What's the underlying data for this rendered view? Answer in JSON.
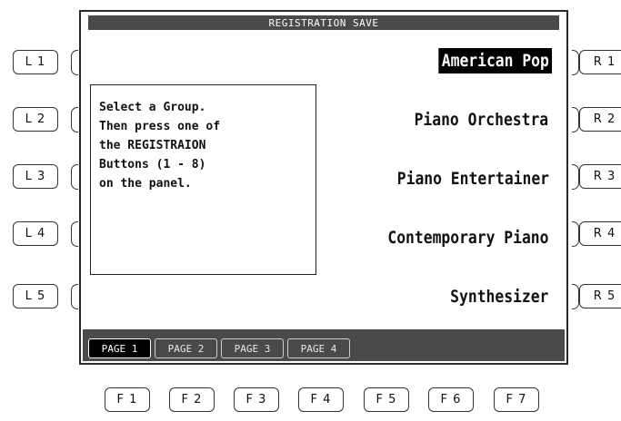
{
  "screen": {
    "title": "REGISTRATION SAVE",
    "message": "Select a Group.\nThen press one of\nthe REGISTRAION\nButtons (1 - 8)\non the panel.",
    "groups": [
      {
        "label": "American Pop",
        "selected": true
      },
      {
        "label": "Piano Orchestra",
        "selected": false
      },
      {
        "label": "Piano Entertainer",
        "selected": false
      },
      {
        "label": "Contemporary Piano",
        "selected": false
      },
      {
        "label": "Synthesizer",
        "selected": false
      }
    ],
    "pages": [
      "PAGE 1",
      "PAGE 2",
      "PAGE 3",
      "PAGE 4"
    ],
    "active_page": "PAGE 1"
  },
  "left_buttons": [
    "L 1",
    "L 2",
    "L 3",
    "L 4",
    "L 5"
  ],
  "right_buttons": [
    "R 1",
    "R 2",
    "R 3",
    "R 4",
    "R 5"
  ],
  "function_buttons": [
    "F 1",
    "F 2",
    "F 3",
    "F 4",
    "F 5",
    "F 6",
    "F 7"
  ],
  "colors": {
    "bar": "#4a4a4a",
    "selected_bg": "#000000",
    "screen_bg": "#ffffff"
  }
}
